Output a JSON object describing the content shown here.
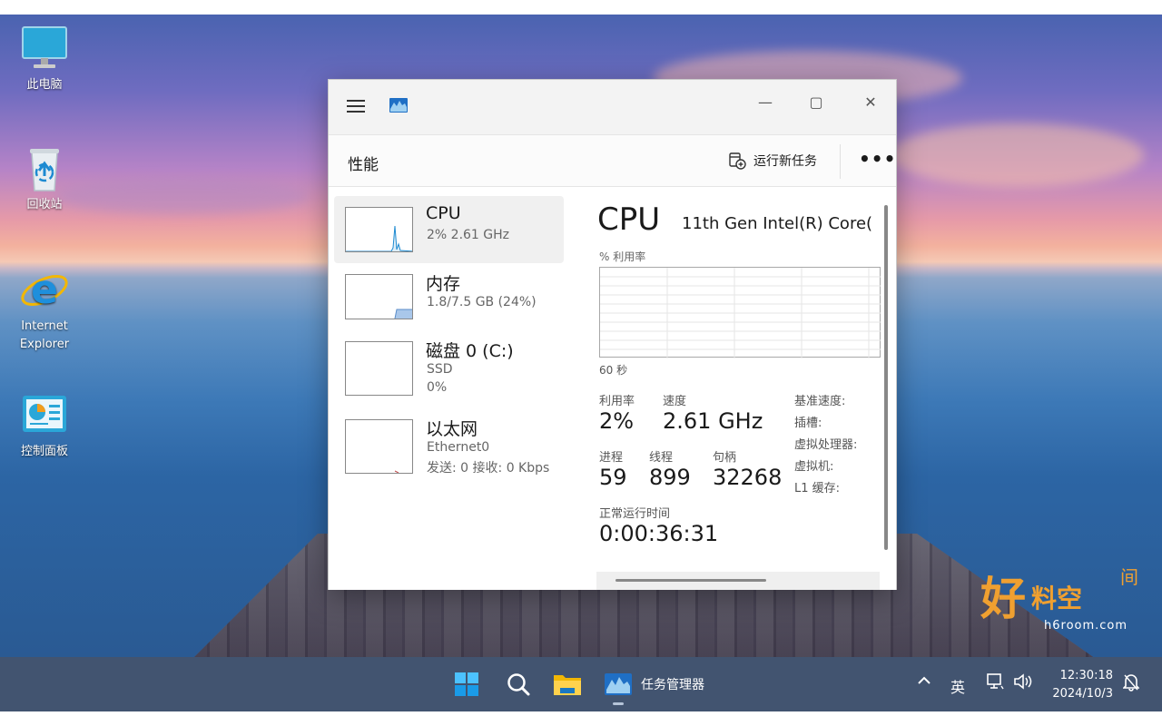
{
  "desktop": {
    "icons": [
      {
        "label": "此电脑"
      },
      {
        "label": "回收站"
      },
      {
        "label": "Internet\nExplorer"
      },
      {
        "label": "控制面板"
      }
    ]
  },
  "watermark": {
    "char1": "好",
    "chars": "料空",
    "char3": "间",
    "url": "h6room.com"
  },
  "window": {
    "page_title": "性能",
    "run_task_label": "运行新任务",
    "more_label": "•••",
    "minimize": "—",
    "maximize": "▢",
    "close": "✕",
    "sidebar": [
      {
        "title": "CPU",
        "sub1": "2% 2.61 GHz",
        "sub2": ""
      },
      {
        "title": "内存",
        "sub1": "1.8/7.5 GB (24%)",
        "sub2": ""
      },
      {
        "title": "磁盘 0 (C:)",
        "sub1": "SSD",
        "sub2": "0%"
      },
      {
        "title": "以太网",
        "sub1": "Ethernet0",
        "sub2": "发送: 0 接收: 0 Kbps"
      }
    ],
    "main": {
      "title": "CPU",
      "model": "11th Gen Intel(R) Core(",
      "util_axis_label": "% 利用率",
      "time_span": "60 秒",
      "stats": {
        "util_label": "利用率",
        "util_value": "2%",
        "speed_label": "速度",
        "speed_value": "2.61 GHz",
        "proc_label": "进程",
        "proc_value": "59",
        "thread_label": "线程",
        "thread_value": "899",
        "handle_label": "句柄",
        "handle_value": "32268",
        "uptime_label": "正常运行时间",
        "uptime_value": "0:00:36:31"
      },
      "specs": [
        "基准速度:",
        "插槽:",
        "虚拟处理器:",
        "虚拟机:",
        "L1 缓存:"
      ]
    }
  },
  "taskbar": {
    "app_label": "任务管理器",
    "ime": "英",
    "time": "12:30:18",
    "date": "2024/10/3"
  },
  "colors": {
    "accent": "#1f6fc5",
    "cpu_line": "#1d8ad1",
    "mem_fill": "#a9c7ea",
    "taskbar": "#283c5c"
  }
}
